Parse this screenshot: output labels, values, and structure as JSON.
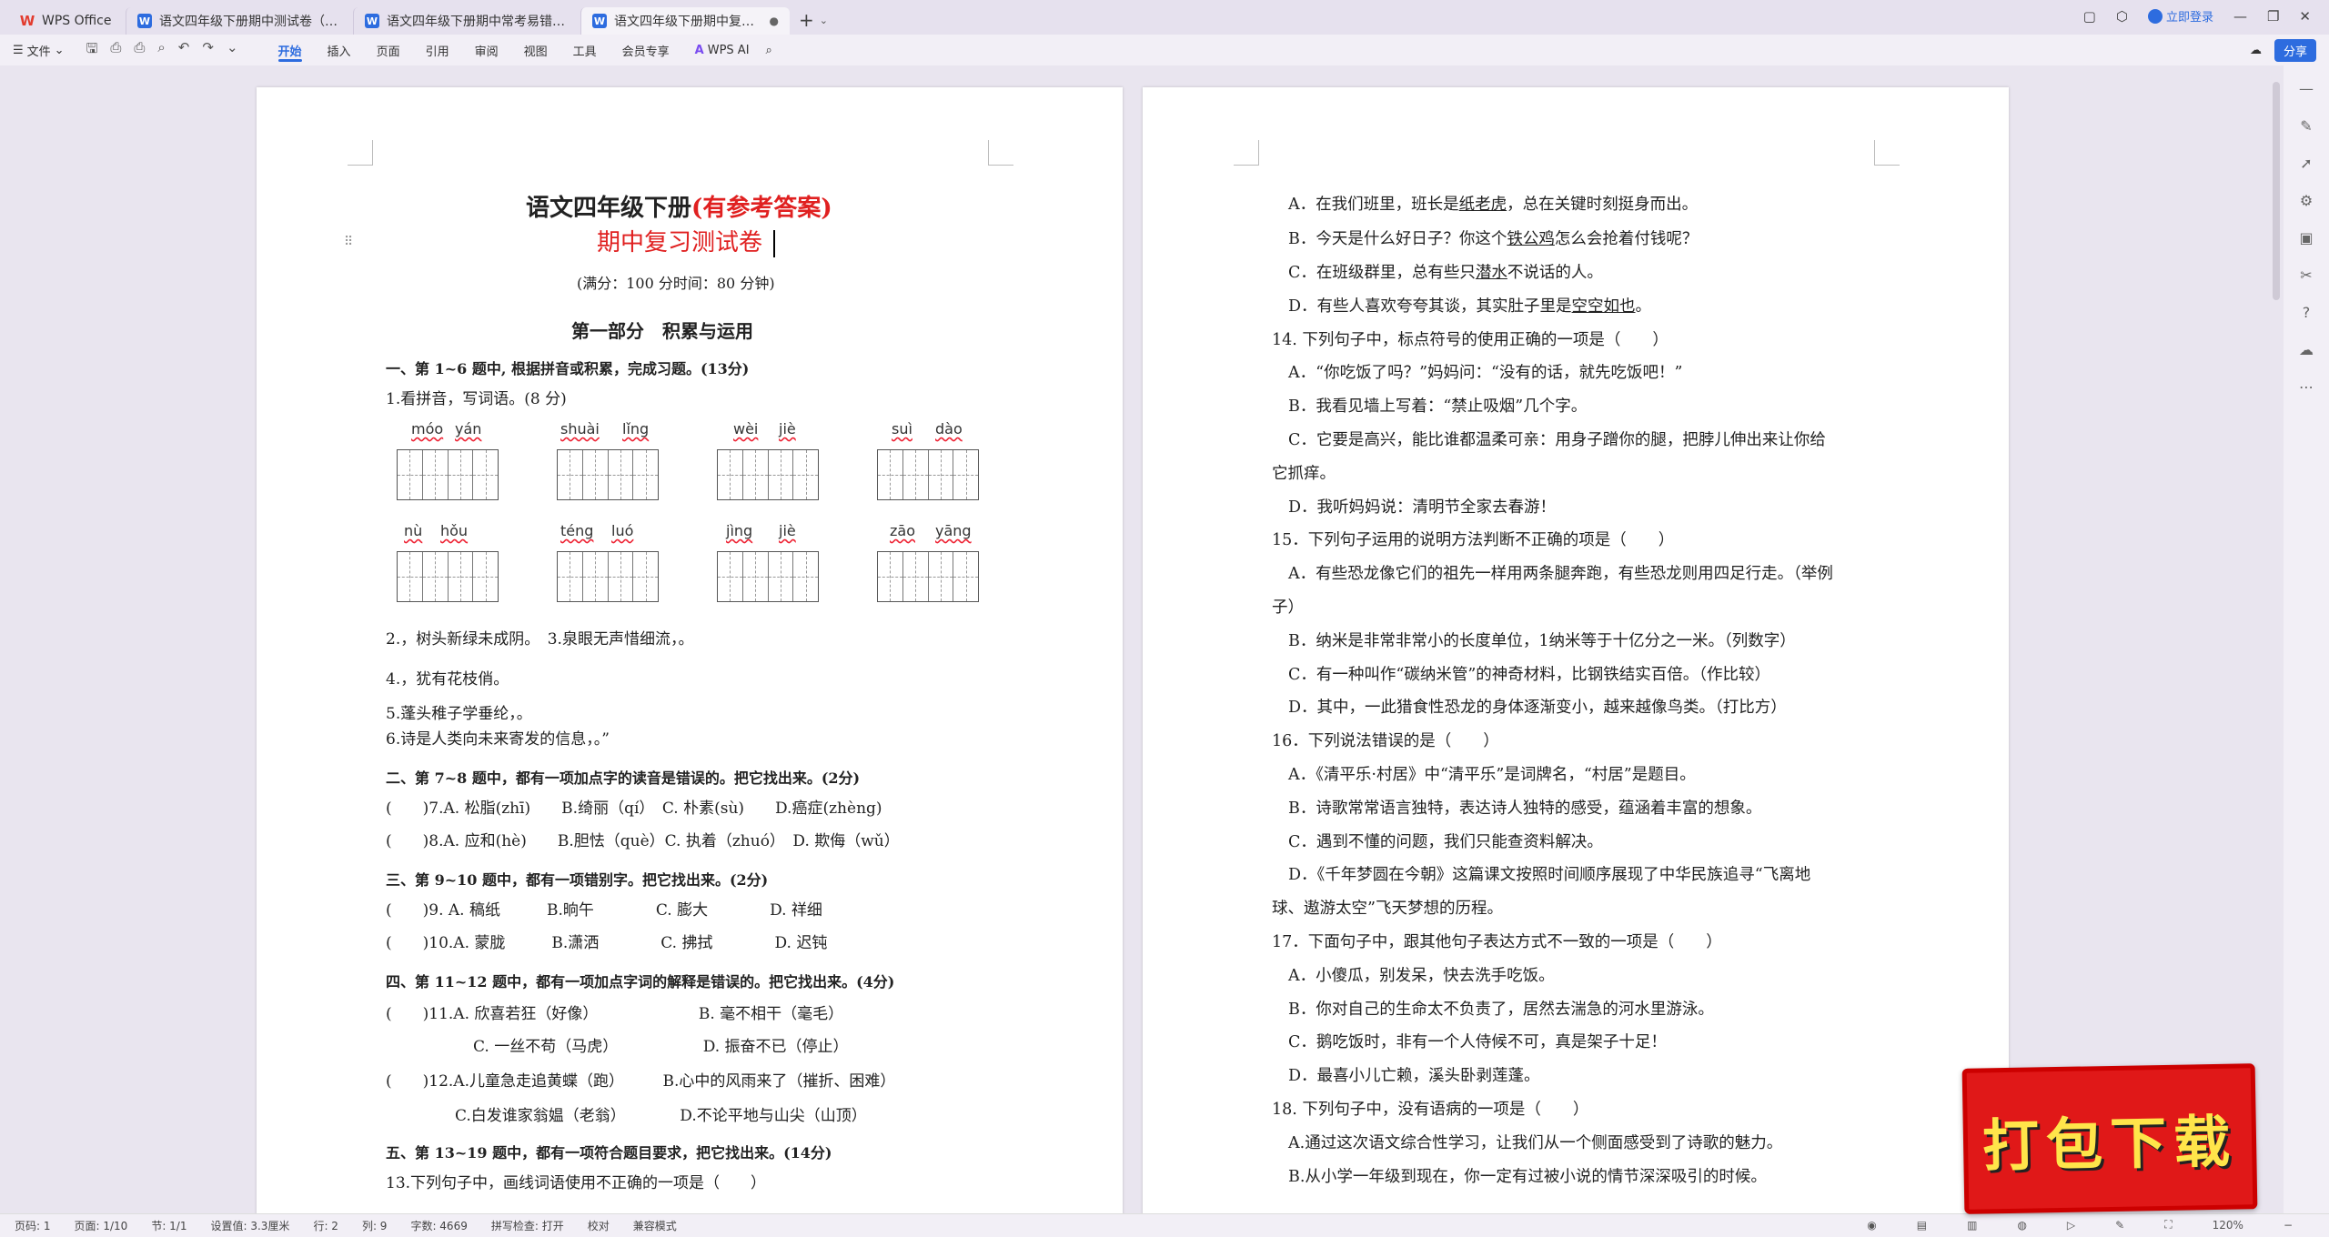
{
  "tabs": [
    {
      "label": "WPS Office",
      "type": "home"
    },
    {
      "label": "语文四年级下册期中测试卷（含答案）",
      "type": "doc"
    },
    {
      "label": "语文四年级下册期中常考易错真题检测",
      "type": "doc"
    },
    {
      "label": "语文四年级下册期中复习测试卷",
      "type": "doc",
      "active": true
    }
  ],
  "tabbar": {
    "login_label": "立即登录",
    "new_tab": "+"
  },
  "menubar": {
    "file_label": "文件",
    "items": [
      "开始",
      "插入",
      "页面",
      "引用",
      "审阅",
      "视图",
      "工具",
      "会员专享"
    ],
    "ai_label": "WPS AI",
    "share_label": "分享"
  },
  "page1": {
    "title_black": "语文四年级下册",
    "title_red": "(有参考答案)",
    "subtitle": "期中复习测试卷",
    "score_line": "(满分：100 分时间：80 分钟)",
    "part_title": "第一部分　积累与运用",
    "sec1": "一、第 1~6 题中, 根据拼音或积累，完成习题。(13分)",
    "q1": "1.看拼音，写词语。(8 分)",
    "pinyin_row1": [
      [
        "móo",
        "yán"
      ],
      [
        "shuài",
        "lǐng"
      ],
      [
        "wèi",
        "jiè"
      ],
      [
        "suì",
        "dào"
      ]
    ],
    "pinyin_row2": [
      [
        "nù",
        "hǒu"
      ],
      [
        "téng",
        "luó"
      ],
      [
        "jìng",
        "jiè"
      ],
      [
        "zāo",
        "yāng"
      ]
    ],
    "q2": "2.，树头新绿未成阴。　3.泉眼无声惜细流，。",
    "q4": "4.，犹有花枝俏。",
    "q5": "5.蓬头稚子学垂纶，。",
    "q6": "6.诗是人类向未来寄发的信息，。”",
    "sec2": "二、第 7~8 题中，都有一项加点字的读音是错误的。把它找出来。(2分)",
    "q7": "(　　)7.A. 松脂(zhī)　　B.绮丽（qí）　C. 朴素(sù)　　D.癌症(zhèng)",
    "q8": "(　　)8.A. 应和(hè)　　B.胆怯（què）C. 执着（zhuó）　D. 欺侮（wǔ）",
    "sec3": "三、第 9~10 题中，都有一项错别字。把它找出来。(2分)",
    "q9": "(　　)9. A. 稿纸　　　B.晌午　　　　C. 膨大　　　　D. 祥细",
    "q10": "(　　)10.A. 蒙胧　　　B.潇洒　　　　C. 拂拭　　　　D. 迟钝",
    "sec4": "四、第 11~12 题中，都有一项加点字词的解释是错误的。把它找出来。(4分)",
    "q11a": "(　　)11.A. 欣喜若狂（好像）　　　　　　　B. 毫不相干（毫毛）",
    "q11b": "C. 一丝不苟（马虎）　　　　　　D. 振奋不已（停止）",
    "q12a": "(　　)12.A.儿童急走追黄蝶（跑）　　　B.心中的风雨来了（摧折、困难）",
    "q12b": "C.白发谁家翁媪（老翁）　　　　D.不论平地与山尖（山顶）",
    "sec5": "五、第 13~19 题中，都有一项符合题目要求，把它找出来。(14分)",
    "q13": "13.下列句子中，画线词语使用不正确的一项是（　　）"
  },
  "page2": {
    "lines": [
      {
        "pre": "A．在我们班里，班长是",
        "u": "纸老虎",
        "post": "，总在关键时刻挺身而出。",
        "indent": true
      },
      {
        "pre": "B．今天是什么好日子？你这个",
        "u": "铁公鸡",
        "post": "怎么会抢着付钱呢？",
        "indent": true
      },
      {
        "pre": "C．在班级群里，总有些只",
        "u": "潜水",
        "post": "不说话的人。",
        "indent": true
      },
      {
        "pre": "D．有些人喜欢夸夸其谈，其实肚子里是",
        "u": "空空如也",
        "post": "。",
        "indent": true
      },
      {
        "pre": "14. 下列句子中，标点符号的使用正确的一项是（　　）",
        "u": "",
        "post": "",
        "indent": false
      },
      {
        "pre": "A．“你吃饭了吗？”妈妈问：“没有的话，就先吃饭吧！”",
        "u": "",
        "post": "",
        "indent": true
      },
      {
        "pre": "B．我看见墙上写着：“禁止吸烟”几个字。",
        "u": "",
        "post": "",
        "indent": true
      },
      {
        "pre": "C．它要是高兴，能比谁都温柔可亲：用身子蹭你的腿，把脖儿伸出来让你给",
        "u": "",
        "post": "",
        "indent": true
      },
      {
        "pre": "它抓痒。",
        "u": "",
        "post": "",
        "indent": false
      },
      {
        "pre": "D．我听妈妈说：清明节全家去春游！",
        "u": "",
        "post": "",
        "indent": true
      },
      {
        "pre": "15．下列句子运用的说明方法判断不正确的项是（　　）",
        "u": "",
        "post": "",
        "indent": false
      },
      {
        "pre": "A．有些恐龙像它们的祖先一样用两条腿奔跑，有些恐龙则用四足行走。（举例",
        "u": "",
        "post": "",
        "indent": true
      },
      {
        "pre": "子）",
        "u": "",
        "post": "",
        "indent": false
      },
      {
        "pre": "B．纳米是非常非常小的长度单位，1纳米等于十亿分之一米。（列数字）",
        "u": "",
        "post": "",
        "indent": true
      },
      {
        "pre": "C．有一种叫作“碳纳米管”的神奇材料，比钢铁结实百倍。（作比较）",
        "u": "",
        "post": "",
        "indent": true
      },
      {
        "pre": "D．其中，一此猎食性恐龙的身体逐渐变小，越来越像鸟类。（打比方）",
        "u": "",
        "post": "",
        "indent": true
      },
      {
        "pre": "16．下列说法错误的是（　　）",
        "u": "",
        "post": "",
        "indent": false
      },
      {
        "pre": "A．《清平乐·村居》中“清平乐”是词牌名，“村居”是题目。",
        "u": "",
        "post": "",
        "indent": true
      },
      {
        "pre": "B．诗歌常常语言独特，表达诗人独特的感受，蕴涵着丰富的想象。",
        "u": "",
        "post": "",
        "indent": true
      },
      {
        "pre": "C．遇到不懂的问题，我们只能查资料解决。",
        "u": "",
        "post": "",
        "indent": true
      },
      {
        "pre": "D．《千年梦圆在今朝》这篇课文按照时间顺序展现了中华民族追寻“飞离地",
        "u": "",
        "post": "",
        "indent": true
      },
      {
        "pre": "球、遨游太空”飞天梦想的历程。",
        "u": "",
        "post": "",
        "indent": false
      },
      {
        "pre": "17．下面句子中，跟其他句子表达方式不一致的一项是（　　）",
        "u": "",
        "post": "",
        "indent": false
      },
      {
        "pre": "A．小傻瓜，别发呆，快去洗手吃饭。",
        "u": "",
        "post": "",
        "indent": true
      },
      {
        "pre": "B．你对自己的生命太不负责了，居然去湍急的河水里游泳。",
        "u": "",
        "post": "",
        "indent": true
      },
      {
        "pre": "C．鹅吃饭时，非有一个人侍候不可，真是架子十足！",
        "u": "",
        "post": "",
        "indent": true
      },
      {
        "pre": "D．最喜小儿亡赖，溪头卧剥莲蓬。",
        "u": "",
        "post": "",
        "indent": true
      },
      {
        "pre": "18. 下列句子中，没有语病的一项是（　　）",
        "u": "",
        "post": "",
        "indent": false
      },
      {
        "pre": "A.通过这次语文综合性学习，让我们从一个侧面感受到了诗歌的魅力。",
        "u": "",
        "post": "",
        "indent": true
      },
      {
        "pre": "B.从小学一年级到现在，你一定有过被小说的情节深深吸引的时候。",
        "u": "",
        "post": "",
        "indent": true
      }
    ]
  },
  "statusbar": {
    "page": "页码: 1",
    "pages": "页面: 1/10",
    "section": "节: 1/1",
    "setting": "设置值: 3.3厘米",
    "row": "行: 2",
    "col": "列: 9",
    "words": "字数: 4669",
    "spell": "拼写检查: 打开",
    "proof": "校对",
    "compat": "兼容模式",
    "zoom": "120%"
  },
  "banner": {
    "text": "打包下载"
  },
  "colors": {
    "accent": "#2d6cdf",
    "title_red": "#e02020",
    "banner_red": "#e01818",
    "banner_text": "#ffe54a"
  }
}
